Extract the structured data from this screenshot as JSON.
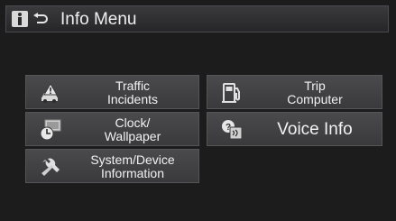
{
  "header": {
    "title": "Info Menu"
  },
  "menu": {
    "traffic": {
      "line1": "Traffic",
      "line2": "Incidents"
    },
    "clock": {
      "line1": "Clock/",
      "line2": "Wallpaper"
    },
    "system": {
      "line1": "System/Device",
      "line2": "Information"
    },
    "trip": {
      "line1": "Trip",
      "line2": "Computer"
    },
    "voice": {
      "label": "Voice Info"
    }
  },
  "icons": {
    "info": "info-icon",
    "back": "back-arrow-icon",
    "traffic": "traffic-car-warning-icon",
    "clock": "clock-wallpaper-icon",
    "system": "wrench-icon",
    "trip": "fuel-pump-icon",
    "voice": "voice-info-icon"
  }
}
